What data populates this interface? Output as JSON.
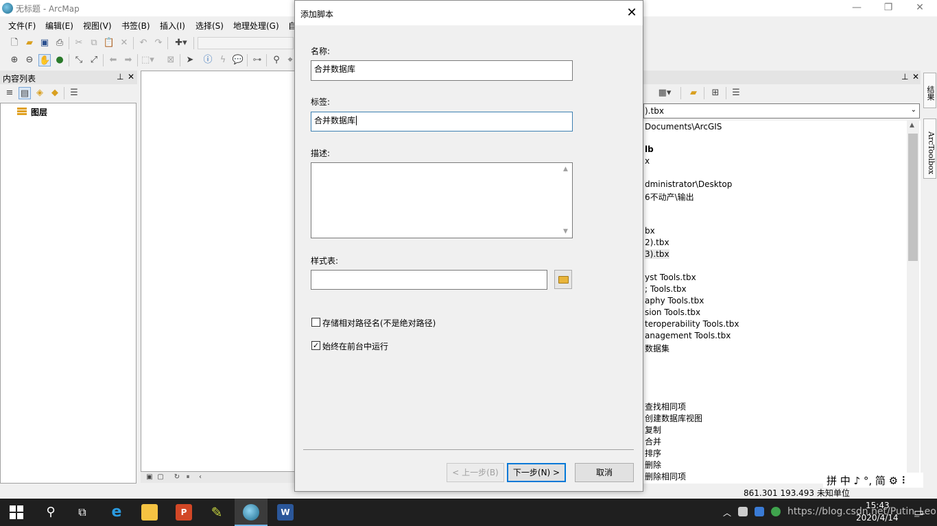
{
  "app": {
    "title": "无标题 - ArcMap"
  },
  "menu": [
    "文件(F)",
    "编辑(E)",
    "视图(V)",
    "书签(B)",
    "插入(I)",
    "选择(S)",
    "地理处理(G)",
    "自"
  ],
  "toc": {
    "header": "内容列表",
    "layers_label": "图层"
  },
  "catalog": {
    "address": ").tbx",
    "lines": [
      "Documents\\ArcGIS",
      "lb",
      "x",
      "dministrator\\Desktop",
      "6不动产\\输出",
      "bx",
      "2).tbx",
      "3).tbx",
      "yst Tools.tbx",
      "; Tools.tbx",
      "aphy Tools.tbx",
      "sion Tools.tbx",
      "teroperability Tools.tbx",
      "anagement Tools.tbx",
      "数据集",
      "查找相同项",
      "创建数据库视图",
      "复制",
      "合并",
      "排序",
      "删除",
      "删除相同项"
    ],
    "side_tabs": [
      "结果",
      "ArcToolbox"
    ]
  },
  "status": {
    "coords": "861.301  193.493 未知单位"
  },
  "ime": "拼 中 ♪ °, 简 ⚙ ⠇",
  "dialog": {
    "title": "添加脚本",
    "name_label": "名称:",
    "name_value": "合并数据库",
    "label_label": "标签:",
    "label_value": "合并数据库",
    "desc_label": "描述:",
    "desc_value": "",
    "stylesheet_label": "样式表:",
    "stylesheet_value": "",
    "relative_paths_label": "存储相对路径名(不是绝对路径)",
    "relative_paths_checked": false,
    "foreground_label": "始终在前台中运行",
    "foreground_checked": true,
    "back_button": "< 上一步(B)",
    "next_button": "下一步(N) >",
    "cancel_button": "取消"
  },
  "taskbar": {
    "time": "15:43",
    "date": "2020/4/14",
    "watermark": "https://blog.csdn.net/Putin_Leon"
  },
  "colors": {
    "accent": "#0078d7",
    "taskbar": "#1f1f1f"
  }
}
